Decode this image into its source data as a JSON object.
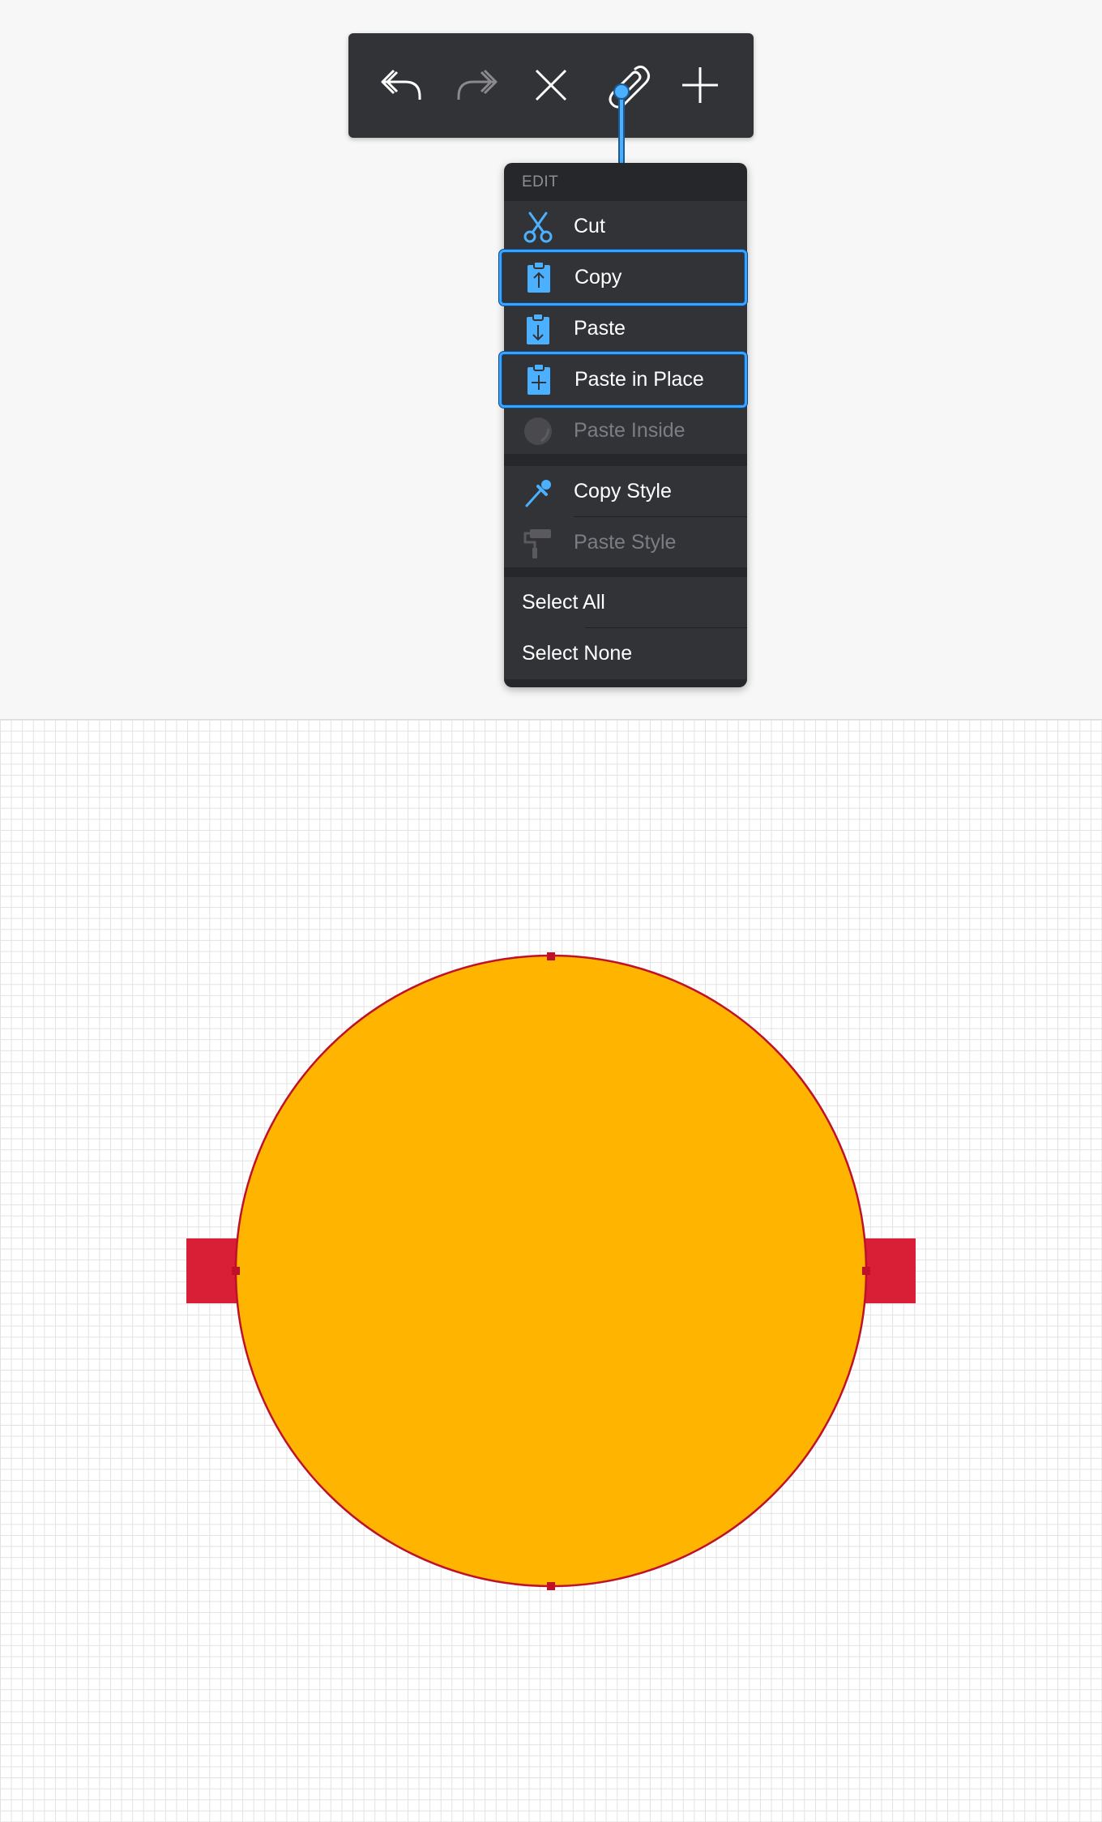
{
  "toolbar": {
    "buttons": [
      {
        "name": "undo",
        "icon": "undo-arrow-icon",
        "enabled": true
      },
      {
        "name": "redo",
        "icon": "redo-arrow-icon",
        "enabled": false
      },
      {
        "name": "close",
        "icon": "close-x-icon",
        "enabled": true
      },
      {
        "name": "attach",
        "icon": "paperclip-icon",
        "enabled": true,
        "active": true
      },
      {
        "name": "add",
        "icon": "plus-icon",
        "enabled": true
      }
    ]
  },
  "menu": {
    "header": "EDIT",
    "items": {
      "cut": {
        "label": "Cut",
        "icon": "scissors-icon",
        "enabled": true,
        "highlighted": false
      },
      "copy": {
        "label": "Copy",
        "icon": "clipboard-up-icon",
        "enabled": true,
        "highlighted": true
      },
      "paste": {
        "label": "Paste",
        "icon": "clipboard-down-icon",
        "enabled": true,
        "highlighted": false
      },
      "paste_in_place": {
        "label": "Paste in Place",
        "icon": "clipboard-plus-icon",
        "enabled": true,
        "highlighted": true
      },
      "paste_inside": {
        "label": "Paste Inside",
        "icon": "circle-icon",
        "enabled": false,
        "highlighted": false
      },
      "copy_style": {
        "label": "Copy Style",
        "icon": "eyedropper-icon",
        "enabled": true,
        "highlighted": false
      },
      "paste_style": {
        "label": "Paste Style",
        "icon": "paint-roller-icon",
        "enabled": false,
        "highlighted": false
      },
      "select_all": {
        "label": "Select All",
        "enabled": true
      },
      "select_none": {
        "label": "Select None",
        "enabled": true
      }
    }
  },
  "colors": {
    "accent": "#3aa2ff",
    "menu_background": "#323337",
    "circle_fill": "#ffb400",
    "circle_stroke": "#c0112a",
    "rectangle_fill": "#d91f36"
  },
  "canvas": {
    "shapes": [
      {
        "type": "circle",
        "icon": "yellow-circle-shape"
      },
      {
        "type": "rectangle",
        "icon": "red-rectangle-shape"
      }
    ]
  }
}
